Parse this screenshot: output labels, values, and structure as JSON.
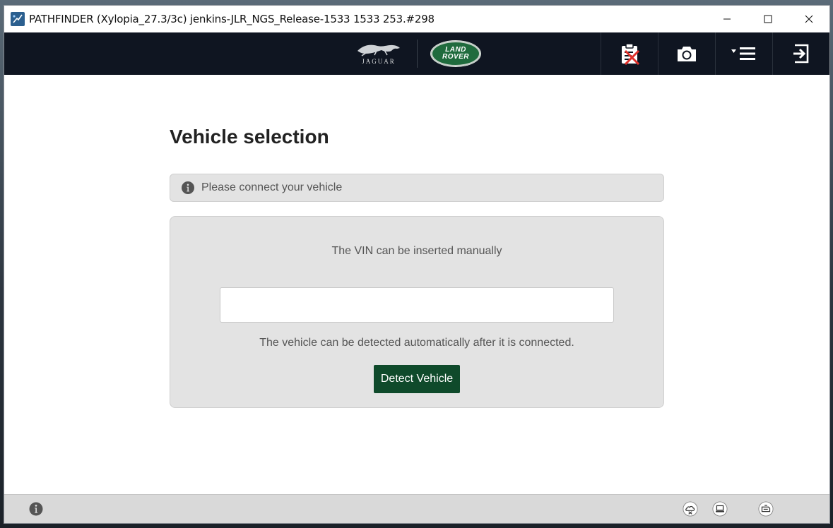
{
  "window": {
    "title": "PATHFINDER (Xylopia_27.3/3c) jenkins-JLR_NGS_Release-1533 1533 253.#298",
    "controls": [
      "minimize",
      "maximize",
      "close"
    ]
  },
  "header": {
    "brands": {
      "jaguar": "JAGUAR",
      "land_rover_line1": "LAND",
      "land_rover_line2": "ROVER"
    },
    "actions": [
      {
        "name": "clipboard-disabled-icon"
      },
      {
        "name": "camera-icon"
      },
      {
        "name": "menu-icon"
      },
      {
        "name": "logout-icon"
      }
    ]
  },
  "main": {
    "title": "Vehicle selection",
    "info_message": "Please connect your vehicle",
    "vin_hint": "The VIN can be inserted manually",
    "vin_value": "",
    "vin_placeholder": "",
    "auto_detect_hint": "The vehicle can be detected automatically after it is connected.",
    "detect_button": "Detect Vehicle"
  },
  "footer": {
    "icons": [
      "info-icon",
      "cloud-status-icon",
      "laptop-status-icon",
      "vci-status-icon"
    ]
  },
  "colors": {
    "header_bg": "#0f1521",
    "panel_bg": "#e3e3e3",
    "primary_button": "#0f4a2b",
    "land_rover_green": "#1f6b3d",
    "footer_bg": "#d9d9d9"
  }
}
